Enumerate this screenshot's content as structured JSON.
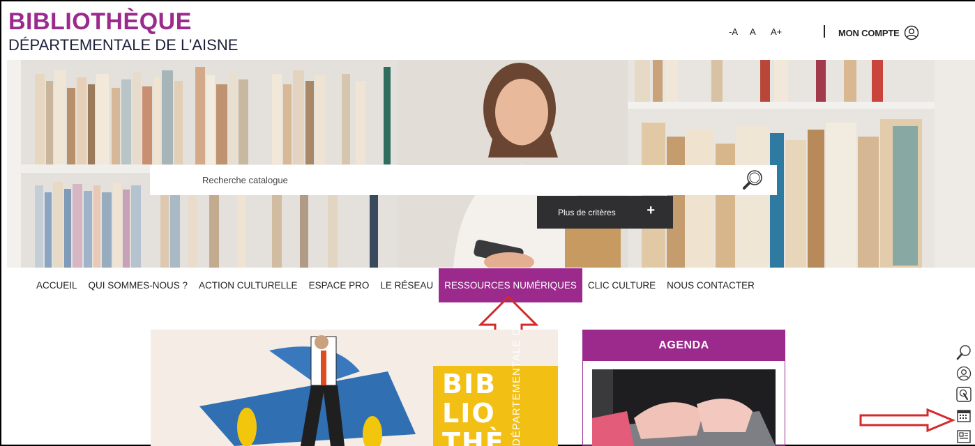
{
  "header": {
    "title": "BIBLIOTHÈQUE",
    "subtitle": "DÉPARTEMENTALE DE L'AISNE",
    "font_tools": [
      "-A",
      "A",
      "A+"
    ],
    "account_label": "MON COMPTE"
  },
  "search": {
    "placeholder": "Recherche catalogue",
    "criteria_label": "Plus de critères",
    "criteria_icon": "+"
  },
  "nav": {
    "items": [
      {
        "label": "ACCUEIL"
      },
      {
        "label": "QUI SOMMES-NOUS ?"
      },
      {
        "label": "ACTION CULTURELLE"
      },
      {
        "label": "ESPACE PRO"
      },
      {
        "label": "LE RÉSEAU"
      },
      {
        "label": "RESSOURCES NUMÉRIQUES",
        "active": true
      },
      {
        "label": "CLIC CULTURE"
      },
      {
        "label": "NOUS CONTACTER"
      }
    ]
  },
  "feature": {
    "poster_letters": [
      "BIB",
      "LIO",
      "THÈ"
    ],
    "poster_side_text": "DÉPARTEMENTALE DE L'AISNE"
  },
  "agenda": {
    "title": "AGENDA"
  },
  "side_tools": [
    "search-icon",
    "user-icon",
    "touch-icon",
    "calendar-icon",
    "news-icon"
  ],
  "colors": {
    "brand": "#9b2a8c",
    "dark_button": "#2f2f31",
    "annotation_arrow": "#d42a2a"
  }
}
